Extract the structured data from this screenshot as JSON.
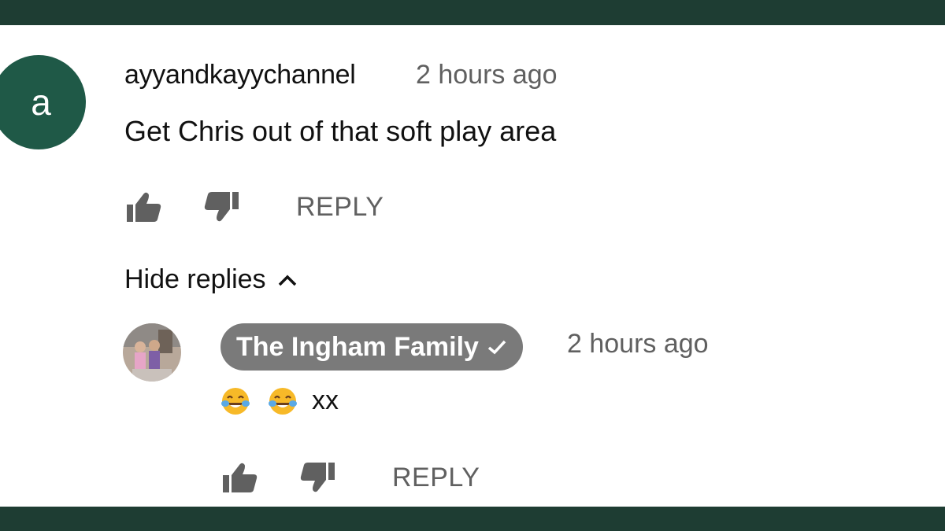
{
  "comment": {
    "avatar_letter": "a",
    "author": "ayyandkayychannel",
    "time": "2 hours ago",
    "text": "Get Chris out of that soft play area",
    "reply_label": "REPLY"
  },
  "hide_replies_label": "Hide replies",
  "reply": {
    "author": "The Ingham Family",
    "verified": true,
    "time": "2 hours ago",
    "emojis": [
      "face-with-tears-of-joy",
      "face-with-tears-of-joy"
    ],
    "text": "xx",
    "reply_label": "REPLY"
  },
  "colors": {
    "frame": "#1e3d33",
    "avatar": "#1f5947",
    "badge": "#7a7a7a",
    "muted": "#606060",
    "text": "#111111"
  },
  "icons": [
    "thumb-up-icon",
    "thumb-down-icon",
    "chevron-up-icon",
    "verified-check-icon",
    "emoji-icon"
  ]
}
